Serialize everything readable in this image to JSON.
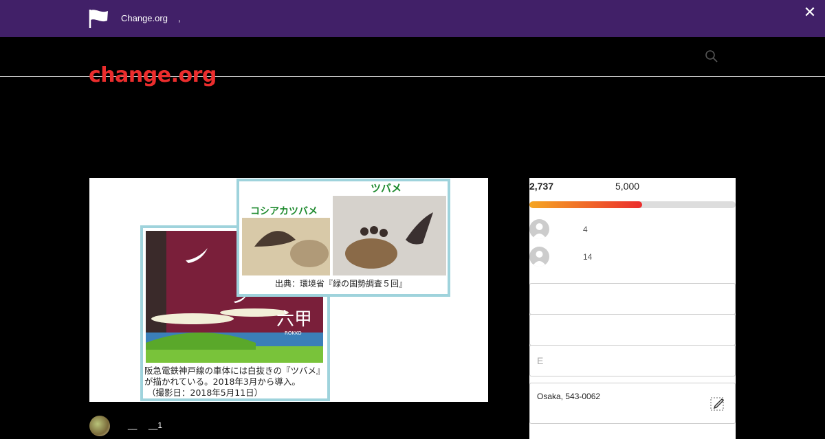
{
  "banner": {
    "brand": "Change.org",
    "suffix": ",",
    "close_label": "✕",
    "color": "#412068"
  },
  "header": {
    "logo": "change.org",
    "logo_color": "#eb2d2d",
    "search_icon": "search-icon"
  },
  "hero_image": {
    "top_title": "ツバメ",
    "top_left_title": "コシアカツバメ",
    "source_caption": "出典：環境省『緑の国勢調査５回』",
    "train_text": "六甲",
    "train_sub": "ROKKO",
    "caption_line1": "阪急電鉄神戸線の車体には白抜きの『ツバメ』",
    "caption_line2": "が描かれている。2018年3月から導入。",
    "caption_line3": "（撮影日：2018年5月11日）"
  },
  "author": {
    "name": "__",
    "count": "__1"
  },
  "petition": {
    "signatures": "2,737",
    "goal": "5,000",
    "progress": 0.547,
    "signers": [
      {
        "text": "4"
      },
      {
        "text": "14"
      }
    ],
    "fields": [
      {
        "placeholder": ""
      },
      {
        "placeholder": ""
      },
      {
        "placeholder": "E"
      }
    ],
    "location": "Osaka, 543-0062",
    "edit_icon": "edit-icon"
  }
}
